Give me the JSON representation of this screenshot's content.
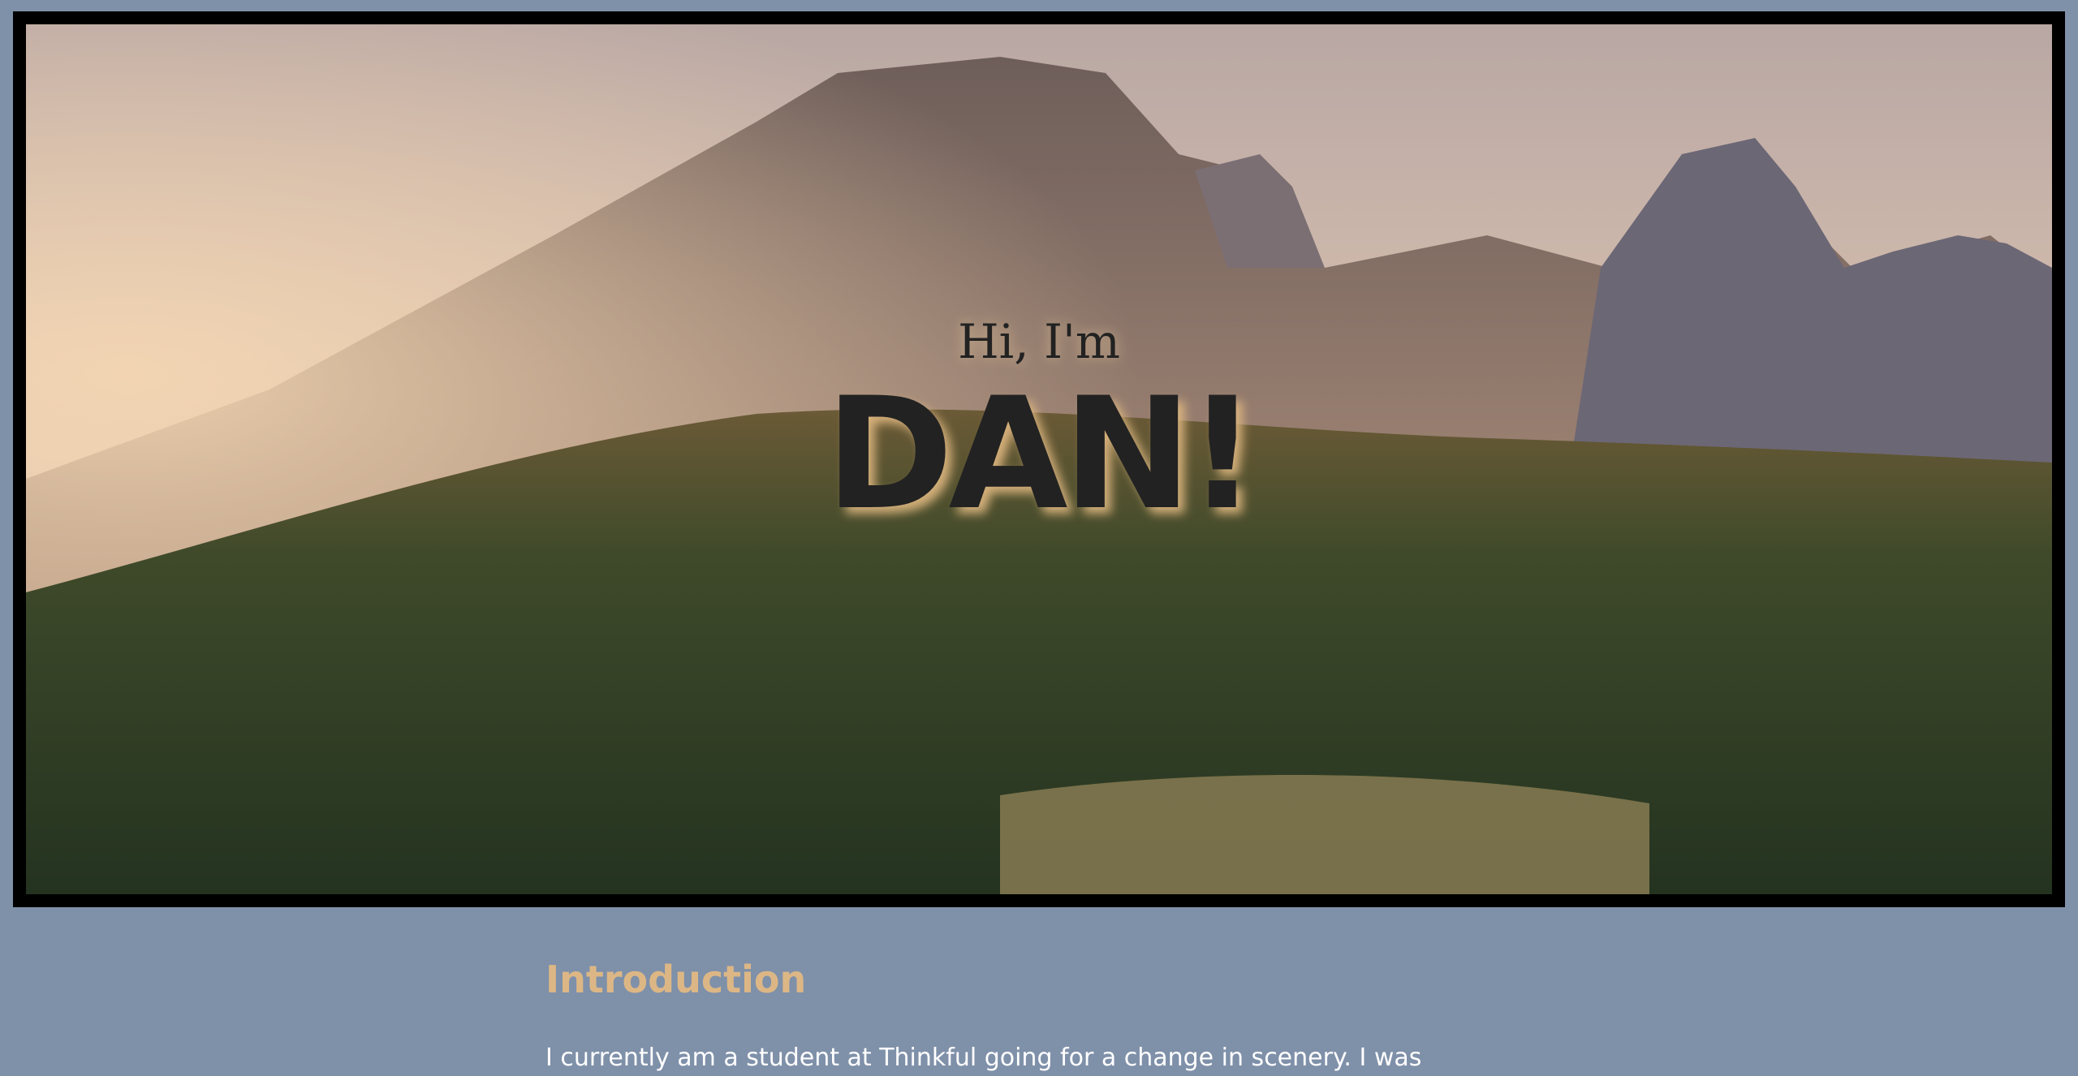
{
  "hero": {
    "greeting": "Hi, I'm",
    "name": "DAN!"
  },
  "intro": {
    "title": "Introduction",
    "text": "I currently am a student at Thinkful going for a change in scenery. I was"
  },
  "colors": {
    "page_bg": "#7f90a9",
    "frame": "#000000",
    "title": "#dcb785",
    "body_text": "#ffffff",
    "hero_text": "#222222"
  }
}
